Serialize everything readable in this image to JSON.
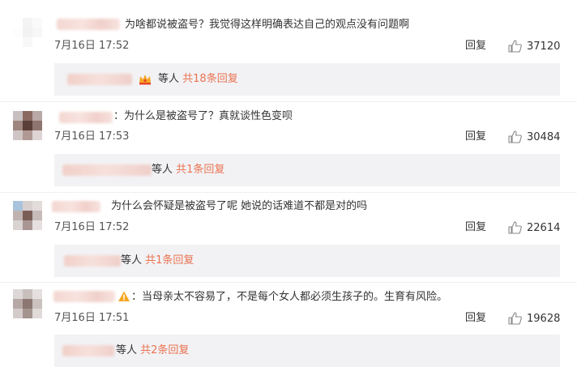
{
  "comments": [
    {
      "text": "为啥都说被盗号？我觉得这样明确表达自己的观点没有问题啊",
      "time": "7月16日 17:52",
      "reply_label": "回复",
      "likes": "37120",
      "sub": {
        "etc": "等人",
        "count": "共18条回复"
      }
    },
    {
      "text": "：为什么是被盗号了？真就谈性色变呗",
      "time": "7月16日 17:53",
      "reply_label": "回复",
      "likes": "30484",
      "sub": {
        "etc": "等人",
        "count": "共1条回复"
      }
    },
    {
      "text": "为什么会怀疑是被盗号了呢 她说的话难道不都是对的吗",
      "time": "7月16日 17:52",
      "reply_label": "回复",
      "likes": "22614",
      "sub": {
        "etc": "等人",
        "count": "共1条回复"
      }
    },
    {
      "text": "：当母亲太不容易了，不是每个女人都必须生孩子的。生育有风险。",
      "time": "7月16日 17:51",
      "reply_label": "回复",
      "likes": "19628",
      "sub": {
        "etc": "等人",
        "count": "共2条回复"
      }
    }
  ],
  "colors": {
    "accent": "#eb7350",
    "sub_background": "#f2f2f5",
    "blur_pink": "#f3d7d1"
  },
  "icons": {
    "like": "thumbs-up-icon",
    "crown": "crown-badge-icon",
    "warning": "warning-badge-icon"
  }
}
